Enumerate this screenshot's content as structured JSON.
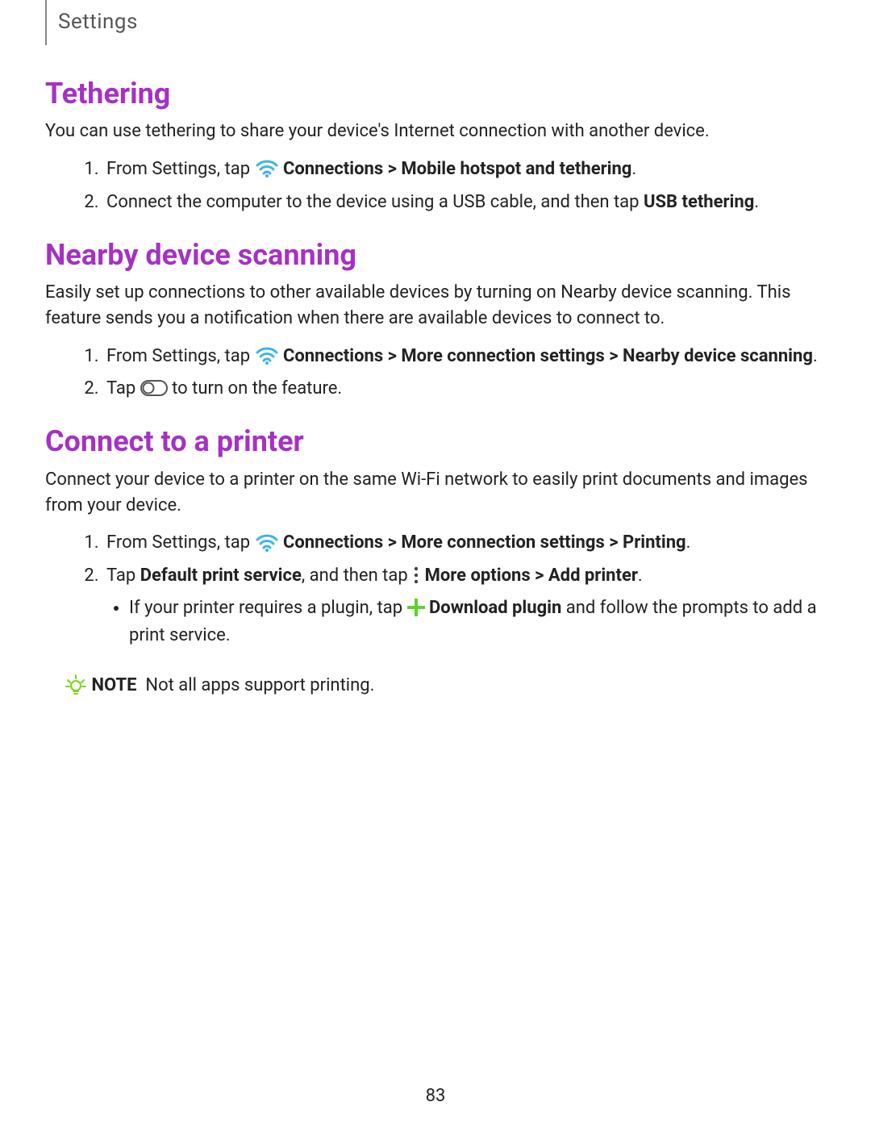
{
  "header": {
    "breadcrumb": "Settings"
  },
  "section1": {
    "title": "Tethering",
    "intro": "You can use tethering to share your device's Internet connection with another device.",
    "step1_prefix": "From Settings, tap ",
    "step1_bold": "Connections > Mobile hotspot and tethering",
    "step1_suffix": ".",
    "step2_prefix": "Connect the computer to the device using a USB cable, and then tap ",
    "step2_bold": "USB tethering",
    "step2_suffix": "."
  },
  "section2": {
    "title": "Nearby device scanning",
    "intro": "Easily set up connections to other available devices by turning on Nearby device scanning. This feature sends you a notification when there are available devices to connect to.",
    "step1_prefix": "From Settings, tap ",
    "step1_bold": "Connections > More connection settings > Nearby device scanning",
    "step1_suffix": ".",
    "step2_prefix": "Tap ",
    "step2_suffix": " to turn on the feature."
  },
  "section3": {
    "title": "Connect to a printer",
    "intro": "Connect your device to a printer on the same Wi-Fi network to easily print documents and images from your device.",
    "step1_prefix": "From Settings, tap ",
    "step1_bold": "Connections > More connection settings > Printing",
    "step1_suffix": ".",
    "step2_prefix": "Tap ",
    "step2_bold1": "Default print service",
    "step2_mid": ", and then tap ",
    "step2_bold2": "More options > Add printer",
    "step2_suffix": ".",
    "sub_prefix": "If your printer requires a plugin, tap ",
    "sub_bold": "Download plugin",
    "sub_suffix": " and follow the prompts to add a print service."
  },
  "note": {
    "label": "NOTE",
    "text": "Not all apps support printing."
  },
  "page": "83"
}
